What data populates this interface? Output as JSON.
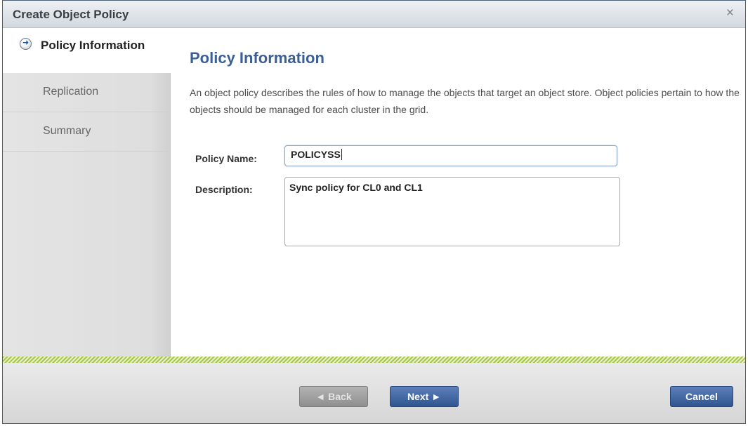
{
  "dialog": {
    "title": "Create Object Policy",
    "close_glyph": "×"
  },
  "sidebar": {
    "items": [
      {
        "label": "Policy Information",
        "active": true,
        "icon": "arrow-circle-icon"
      },
      {
        "label": "Replication",
        "active": false
      },
      {
        "label": "Summary",
        "active": false
      }
    ]
  },
  "main": {
    "heading": "Policy Information",
    "description": "An object policy describes the rules of how to manage the objects that target an object store. Object policies pertain to how the objects should be managed for each cluster in the grid.",
    "policy_name_label": "Policy Name:",
    "policy_name_value": "POLICYSS",
    "description_label": "Description:",
    "description_value": "Sync policy for CL0 and CL1"
  },
  "footer": {
    "back_label": "◄ Back",
    "next_label": "Next ►",
    "cancel_label": "Cancel"
  },
  "colors": {
    "heading": "#3b5f95",
    "primary_button": "#30558f",
    "disabled_button": "#9a9a9a",
    "stripe": "#a7c64b"
  }
}
